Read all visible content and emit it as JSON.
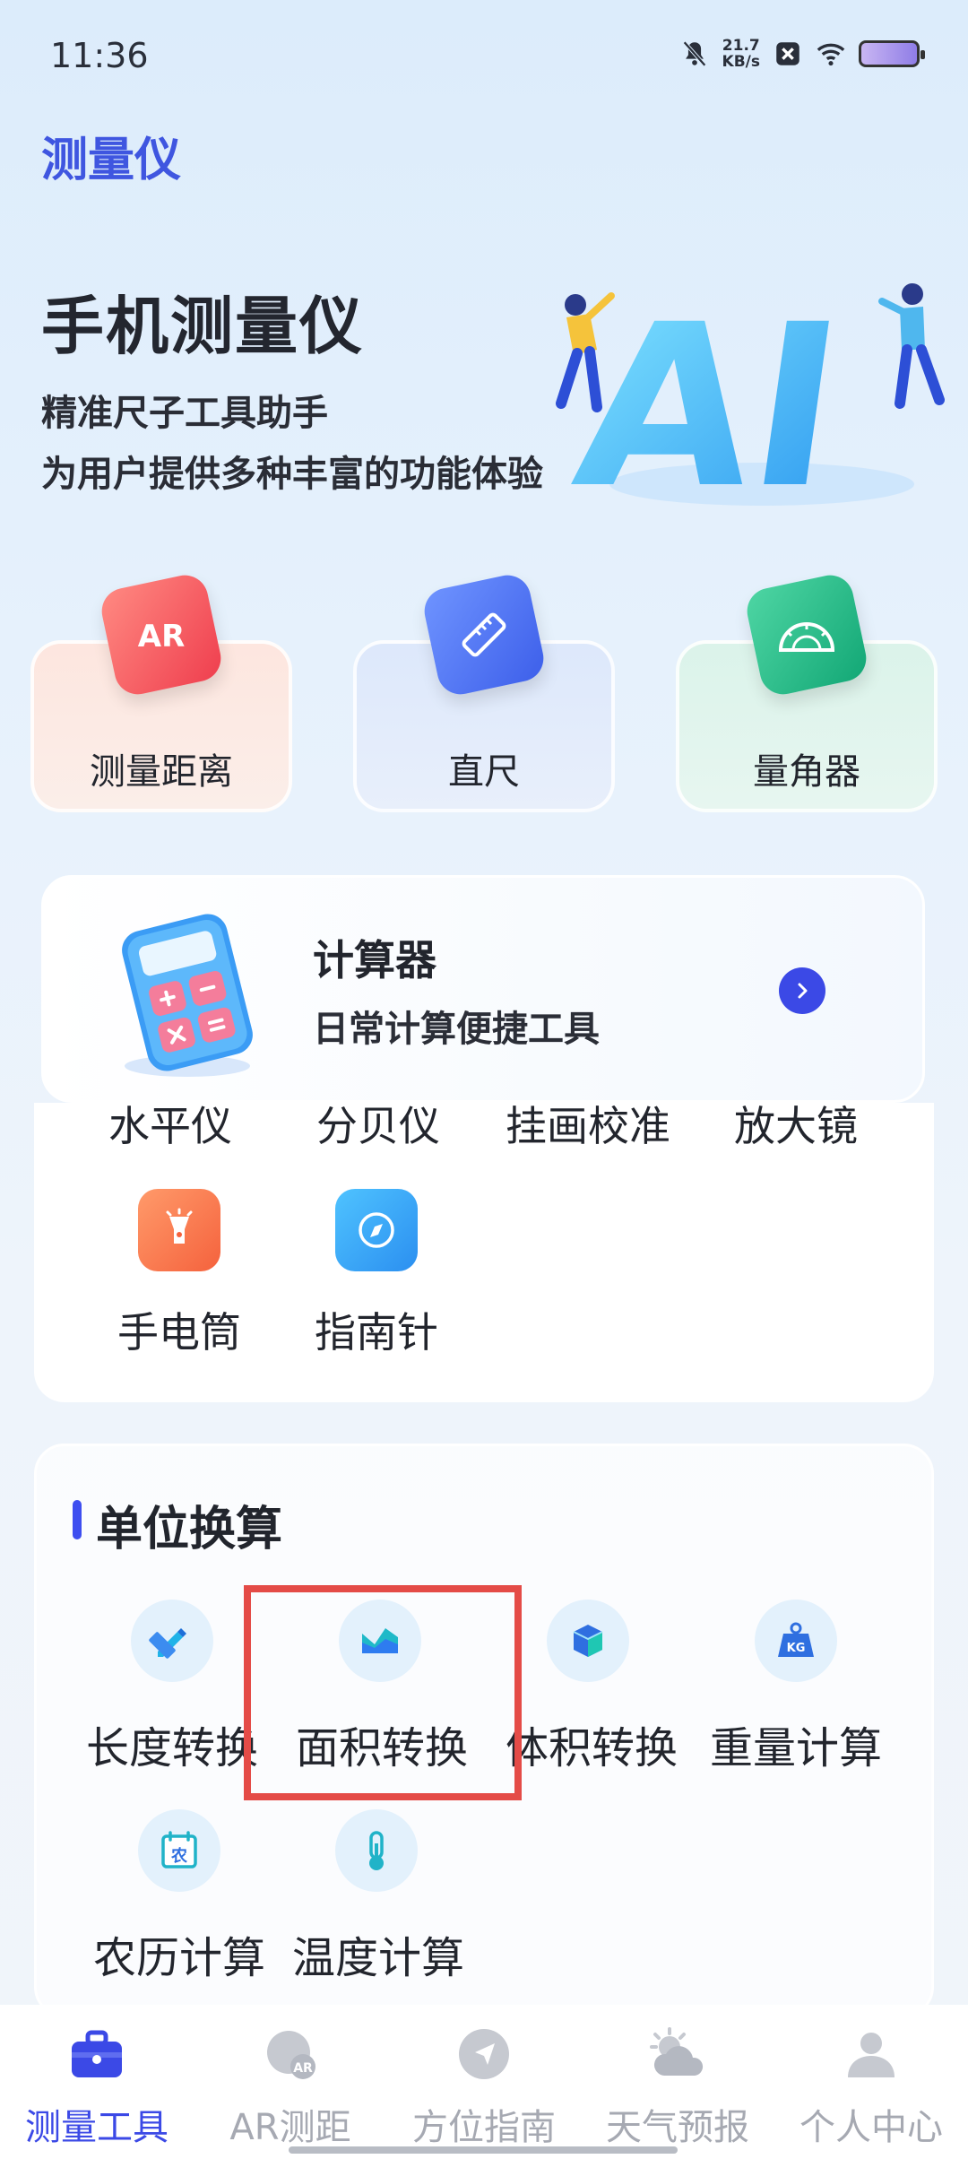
{
  "status_bar": {
    "time": "11:36",
    "net_speed_value": "21.7",
    "net_speed_unit": "KB/s"
  },
  "app_title": "测量仪",
  "hero": {
    "title": "手机测量仪",
    "subtitle_line1": "精准尺子工具助手",
    "subtitle_line2": "为用户提供多种丰富的功能体验",
    "art_text": "AI"
  },
  "feature_cards": [
    {
      "label": "测量距离",
      "icon": "ar-icon",
      "badge": "AR"
    },
    {
      "label": "直尺",
      "icon": "ruler-icon"
    },
    {
      "label": "量角器",
      "icon": "protractor-icon"
    }
  ],
  "calculator": {
    "title": "计算器",
    "subtitle": "日常计算便捷工具"
  },
  "tools": [
    {
      "label": "水平仪"
    },
    {
      "label": "分贝仪"
    },
    {
      "label": "挂画校准"
    },
    {
      "label": "放大镜"
    },
    {
      "label": "手电筒",
      "icon": "flashlight-icon"
    },
    {
      "label": "指南针",
      "icon": "compass-icon"
    }
  ],
  "unit_conversion": {
    "title": "单位换算",
    "items": [
      {
        "label": "长度转换",
        "icon": "pencil-ruler-icon"
      },
      {
        "label": "面积转换",
        "icon": "area-chart-icon"
      },
      {
        "label": "体积转换",
        "icon": "cube-icon"
      },
      {
        "label": "重量计算",
        "icon": "weight-icon",
        "badge": "KG"
      },
      {
        "label": "农历计算",
        "icon": "calendar-icon",
        "badge": "农"
      },
      {
        "label": "温度计算",
        "icon": "thermometer-icon"
      }
    ]
  },
  "bottom_nav": [
    {
      "label": "测量工具",
      "icon": "toolbox-icon",
      "active": true
    },
    {
      "label": "AR测距",
      "icon": "ar-bubble-icon",
      "badge": "AR"
    },
    {
      "label": "方位指南",
      "icon": "navigation-icon"
    },
    {
      "label": "天气预报",
      "icon": "weather-icon"
    },
    {
      "label": "个人中心",
      "icon": "user-icon"
    }
  ],
  "colors": {
    "accent": "#3b49e6",
    "title_blue": "#3f56e0",
    "highlight": "#e44b47",
    "inactive": "#a6a9b2"
  }
}
